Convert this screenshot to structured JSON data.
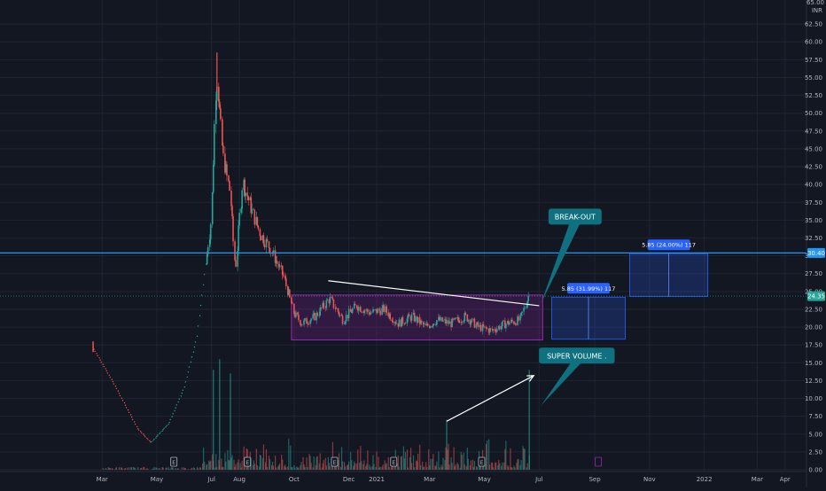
{
  "chart_data": {
    "type": "candlestick",
    "currency": "INR",
    "currency_top": "65.00",
    "yaxis": {
      "min": 0,
      "max": 65,
      "ticks": [
        "62.50",
        "60.00",
        "57.50",
        "55.00",
        "52.50",
        "50.00",
        "47.50",
        "45.00",
        "42.50",
        "40.00",
        "37.50",
        "35.00",
        "32.50",
        "30.00",
        "27.50",
        "25.00",
        "22.50",
        "20.00",
        "17.50",
        "15.00",
        "12.50",
        "10.00",
        "7.50",
        "5.00",
        "2.50",
        "0.00"
      ]
    },
    "xaxis": {
      "start": "2020-02-15",
      "end": "2022-04-20",
      "labels": [
        {
          "text": "Mar",
          "date": "2020-03-01"
        },
        {
          "text": "May",
          "date": "2020-05-01"
        },
        {
          "text": "Jul",
          "date": "2020-07-01"
        },
        {
          "text": "Aug",
          "date": "2020-08-01"
        },
        {
          "text": "Oct",
          "date": "2020-10-01"
        },
        {
          "text": "Dec",
          "date": "2020-12-01"
        },
        {
          "text": "2021",
          "date": "2021-01-01"
        },
        {
          "text": "Mar",
          "date": "2021-03-01"
        },
        {
          "text": "May",
          "date": "2021-05-01"
        },
        {
          "text": "Jul",
          "date": "2021-07-01"
        },
        {
          "text": "Sep",
          "date": "2021-09-01"
        },
        {
          "text": "Nov",
          "date": "2021-11-01"
        },
        {
          "text": "2022",
          "date": "2022-01-01"
        },
        {
          "text": "Mar",
          "date": "2022-03-01"
        },
        {
          "text": "Apr",
          "date": "2022-04-01"
        }
      ]
    },
    "price_path": [
      {
        "date": "2020-02-20",
        "close": 17.2
      },
      {
        "date": "2020-03-15",
        "close": 12.0
      },
      {
        "date": "2020-04-10",
        "close": 5.8
      },
      {
        "date": "2020-04-25",
        "close": 3.8
      },
      {
        "date": "2020-05-15",
        "close": 6.5
      },
      {
        "date": "2020-06-01",
        "close": 11.5
      },
      {
        "date": "2020-06-15",
        "close": 18.5
      },
      {
        "date": "2020-07-01",
        "close": 35.0
      },
      {
        "date": "2020-07-07",
        "close": 56.0
      },
      {
        "date": "2020-07-14",
        "close": 44.0
      },
      {
        "date": "2020-07-22",
        "close": 39.0
      },
      {
        "date": "2020-07-28",
        "close": 28.0
      },
      {
        "date": "2020-08-05",
        "close": 40.5
      },
      {
        "date": "2020-08-15",
        "close": 36.5
      },
      {
        "date": "2020-08-25",
        "close": 33.0
      },
      {
        "date": "2020-09-05",
        "close": 31.0
      },
      {
        "date": "2020-09-20",
        "close": 27.0
      },
      {
        "date": "2020-10-01",
        "close": 22.0
      },
      {
        "date": "2020-10-10",
        "close": 20.5
      },
      {
        "date": "2020-10-25",
        "close": 21.5
      },
      {
        "date": "2020-11-10",
        "close": 24.0
      },
      {
        "date": "2020-11-25",
        "close": 21.0
      },
      {
        "date": "2020-12-10",
        "close": 23.0
      },
      {
        "date": "2020-12-25",
        "close": 22.0
      },
      {
        "date": "2021-01-10",
        "close": 22.5
      },
      {
        "date": "2021-01-25",
        "close": 20.5
      },
      {
        "date": "2021-02-10",
        "close": 21.5
      },
      {
        "date": "2021-02-25",
        "close": 20.0
      },
      {
        "date": "2021-03-10",
        "close": 21.0
      },
      {
        "date": "2021-03-25",
        "close": 20.5
      },
      {
        "date": "2021-04-10",
        "close": 21.5
      },
      {
        "date": "2021-04-25",
        "close": 20.0
      },
      {
        "date": "2021-05-10",
        "close": 19.5
      },
      {
        "date": "2021-05-25",
        "close": 20.5
      },
      {
        "date": "2021-06-10",
        "close": 21.0
      },
      {
        "date": "2021-06-20",
        "close": 24.4
      }
    ],
    "volume_spikes": [
      {
        "date": "2020-07-03",
        "value": 14.0
      },
      {
        "date": "2020-07-10",
        "value": 15.5
      },
      {
        "date": "2020-07-22",
        "value": 13.5
      },
      {
        "date": "2021-03-20",
        "value": 7.0
      },
      {
        "date": "2021-06-20",
        "value": 14.0
      }
    ],
    "horizontal_lines": [
      {
        "price": 30.4,
        "label": "30.40",
        "color": "#2196f3"
      },
      {
        "price": 24.35,
        "label": "24.35",
        "color": "#26a69a"
      }
    ],
    "trendline": {
      "start": {
        "date": "2020-11-08",
        "price": 26.5
      },
      "end": {
        "date": "2021-07-01",
        "price": 23.0
      }
    },
    "consolidation_box": {
      "start": "2020-09-28",
      "end": "2021-07-05",
      "top": 24.5,
      "bottom": 18.2
    },
    "volume_arrow": {
      "start": {
        "date": "2021-03-20",
        "price": 6.8
      },
      "end": {
        "date": "2021-06-25",
        "price": 13.2
      }
    },
    "annotations": [
      {
        "text": "BREAK-OUT",
        "date": "2021-08-10",
        "price": 35.5,
        "target": {
          "date": "2021-07-03",
          "price": 23.3
        }
      },
      {
        "text": "SUPER VOLUME .",
        "date": "2021-08-12",
        "price": 16.0,
        "target": {
          "date": "2021-07-03",
          "price": 9.0
        }
      }
    ],
    "measurements": [
      {
        "label": "5.85 (31.99%) 117",
        "start": "2021-07-15",
        "end": "2021-10-05",
        "top": 24.2,
        "bottom": 18.3
      },
      {
        "label": "5.85 (24.00%) 117",
        "start": "2021-10-10",
        "end": "2022-01-05",
        "top": 30.3,
        "bottom": 24.3
      }
    ],
    "event_markers": [
      {
        "date": "2020-05-20",
        "kind": "E"
      },
      {
        "date": "2020-08-10",
        "kind": "E"
      },
      {
        "date": "2020-11-15",
        "kind": "E"
      },
      {
        "date": "2021-01-20",
        "kind": "E"
      },
      {
        "date": "2021-04-28",
        "kind": "E"
      },
      {
        "date": "2021-09-05",
        "kind": "future"
      }
    ],
    "colors": {
      "up": "#26a69a",
      "down": "#ef5350",
      "box": "#9c27b0",
      "measure": "#2962ff",
      "callout": "#0f7080",
      "line_blue": "#2196f3",
      "line_teal": "#26a69a"
    }
  }
}
